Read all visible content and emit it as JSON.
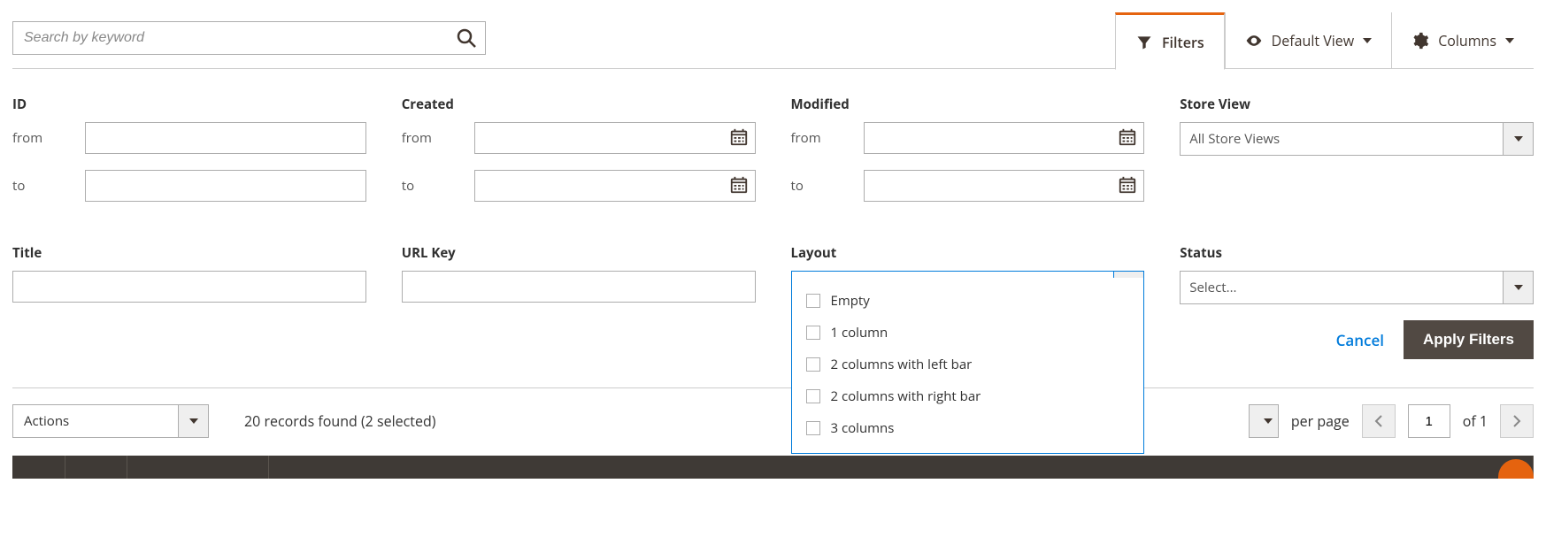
{
  "search": {
    "placeholder": "Search by keyword"
  },
  "toolbar": {
    "filters": "Filters",
    "default_view": "Default View",
    "columns": "Columns"
  },
  "filters": {
    "id_label": "ID",
    "created_label": "Created",
    "modified_label": "Modified",
    "store_view_label": "Store View",
    "title_label": "Title",
    "url_key_label": "URL Key",
    "layout_label": "Layout",
    "status_label": "Status",
    "from": "from",
    "to": "to",
    "store_view_value": "All Store Views",
    "select_placeholder": "Select...",
    "layout_options": [
      "Empty",
      "1 column",
      "2 columns with left bar",
      "2 columns with right bar",
      "3 columns"
    ]
  },
  "actions": {
    "cancel": "Cancel",
    "apply": "Apply Filters",
    "actions_label": "Actions"
  },
  "footer": {
    "records": "20 records found (2 selected)",
    "per_page": "per page",
    "current_page": "1",
    "of": "of 1"
  }
}
